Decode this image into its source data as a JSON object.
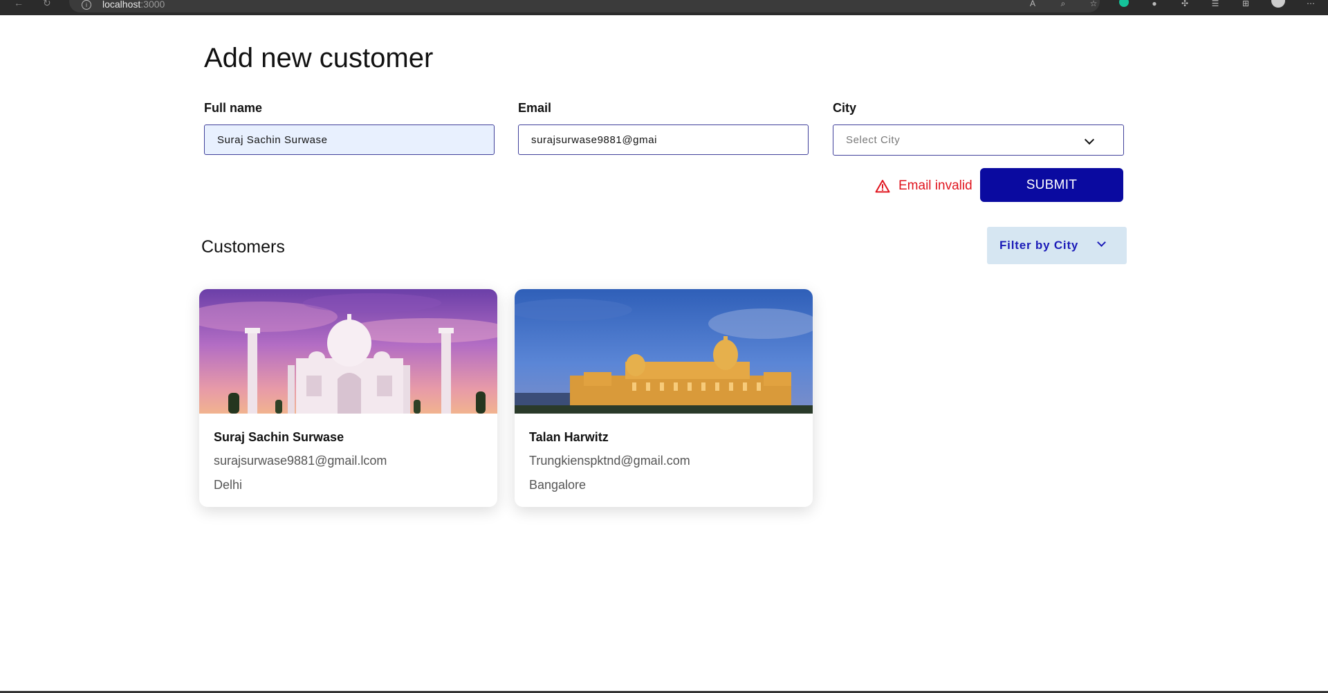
{
  "browser": {
    "url_host": "localhost",
    "url_port": ":3000"
  },
  "form": {
    "title": "Add new customer",
    "full_name": {
      "label": "Full name",
      "value": "Suraj Sachin Surwase"
    },
    "email": {
      "label": "Email",
      "value": "surajsurwase9881@gmai"
    },
    "city": {
      "label": "City",
      "placeholder": "Select City"
    },
    "error_message": "Email invalid",
    "submit_label": "SUBMIT"
  },
  "customers": {
    "title": "Customers",
    "filter_label": "Filter by City",
    "items": [
      {
        "name": "Suraj Sachin Surwase",
        "email": "surajsurwase9881@gmail.lcom",
        "city": "Delhi",
        "image": "taj-mahal-sunset-photo"
      },
      {
        "name": "Talan Harwitz",
        "email": "Trungkienspktnd@gmail.com",
        "city": "Bangalore",
        "image": "vidhana-soudha-night-photo"
      }
    ]
  },
  "colors": {
    "primary": "#0a0aa0",
    "error": "#e0141e",
    "filter_bg": "#d6e6f2",
    "autofill_bg": "#e8f0fe"
  }
}
